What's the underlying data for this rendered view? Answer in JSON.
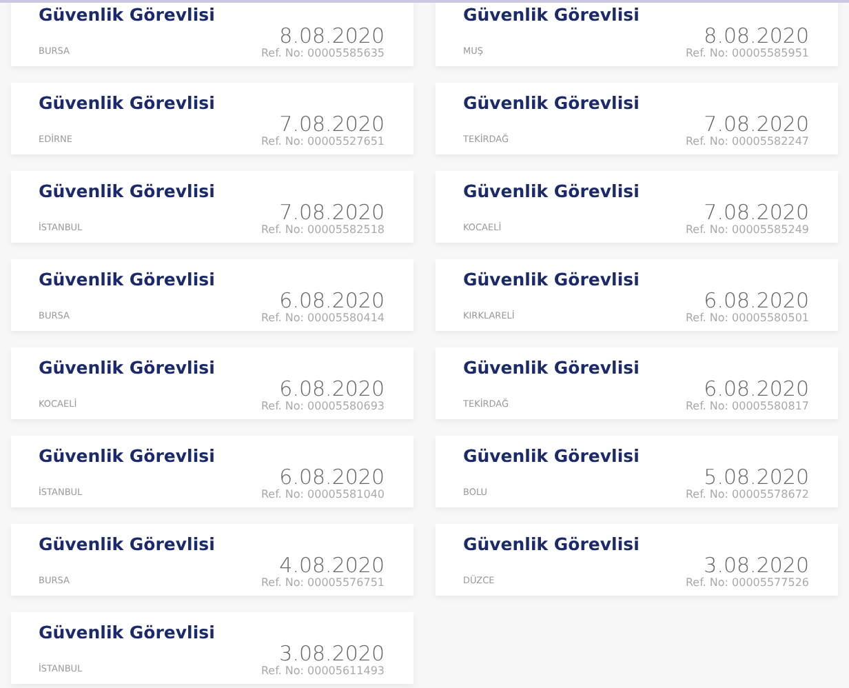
{
  "jobs": [
    {
      "title": "Güvenlik Görevlisi",
      "city": "BURSA",
      "date": "8.08.2020",
      "ref": "Ref. No: 00005585635"
    },
    {
      "title": "Güvenlik Görevlisi",
      "city": "MUŞ",
      "date": "8.08.2020",
      "ref": "Ref. No: 00005585951"
    },
    {
      "title": "Güvenlik Görevlisi",
      "city": "EDİRNE",
      "date": "7.08.2020",
      "ref": "Ref. No: 00005527651"
    },
    {
      "title": "Güvenlik Görevlisi",
      "city": "TEKİRDAĞ",
      "date": "7.08.2020",
      "ref": "Ref. No: 00005582247"
    },
    {
      "title": "Güvenlik Görevlisi",
      "city": "İSTANBUL",
      "date": "7.08.2020",
      "ref": "Ref. No: 00005582518"
    },
    {
      "title": "Güvenlik Görevlisi",
      "city": "KOCAELİ",
      "date": "7.08.2020",
      "ref": "Ref. No: 00005585249"
    },
    {
      "title": "Güvenlik Görevlisi",
      "city": "BURSA",
      "date": "6.08.2020",
      "ref": "Ref. No: 00005580414"
    },
    {
      "title": "Güvenlik Görevlisi",
      "city": "KIRKLARELİ",
      "date": "6.08.2020",
      "ref": "Ref. No: 00005580501"
    },
    {
      "title": "Güvenlik Görevlisi",
      "city": "KOCAELİ",
      "date": "6.08.2020",
      "ref": "Ref. No: 00005580693"
    },
    {
      "title": "Güvenlik Görevlisi",
      "city": "TEKİRDAĞ",
      "date": "6.08.2020",
      "ref": "Ref. No: 00005580817"
    },
    {
      "title": "Güvenlik Görevlisi",
      "city": "İSTANBUL",
      "date": "6.08.2020",
      "ref": "Ref. No: 00005581040"
    },
    {
      "title": "Güvenlik Görevlisi",
      "city": "BOLU",
      "date": "5.08.2020",
      "ref": "Ref. No: 00005578672"
    },
    {
      "title": "Güvenlik Görevlisi",
      "city": "BURSA",
      "date": "4.08.2020",
      "ref": "Ref. No: 00005576751"
    },
    {
      "title": "Güvenlik Görevlisi",
      "city": "DÜZCE",
      "date": "3.08.2020",
      "ref": "Ref. No: 00005577526"
    },
    {
      "title": "Güvenlik Görevlisi",
      "city": "İSTANBUL",
      "date": "3.08.2020",
      "ref": "Ref. No: 00005611493"
    }
  ]
}
